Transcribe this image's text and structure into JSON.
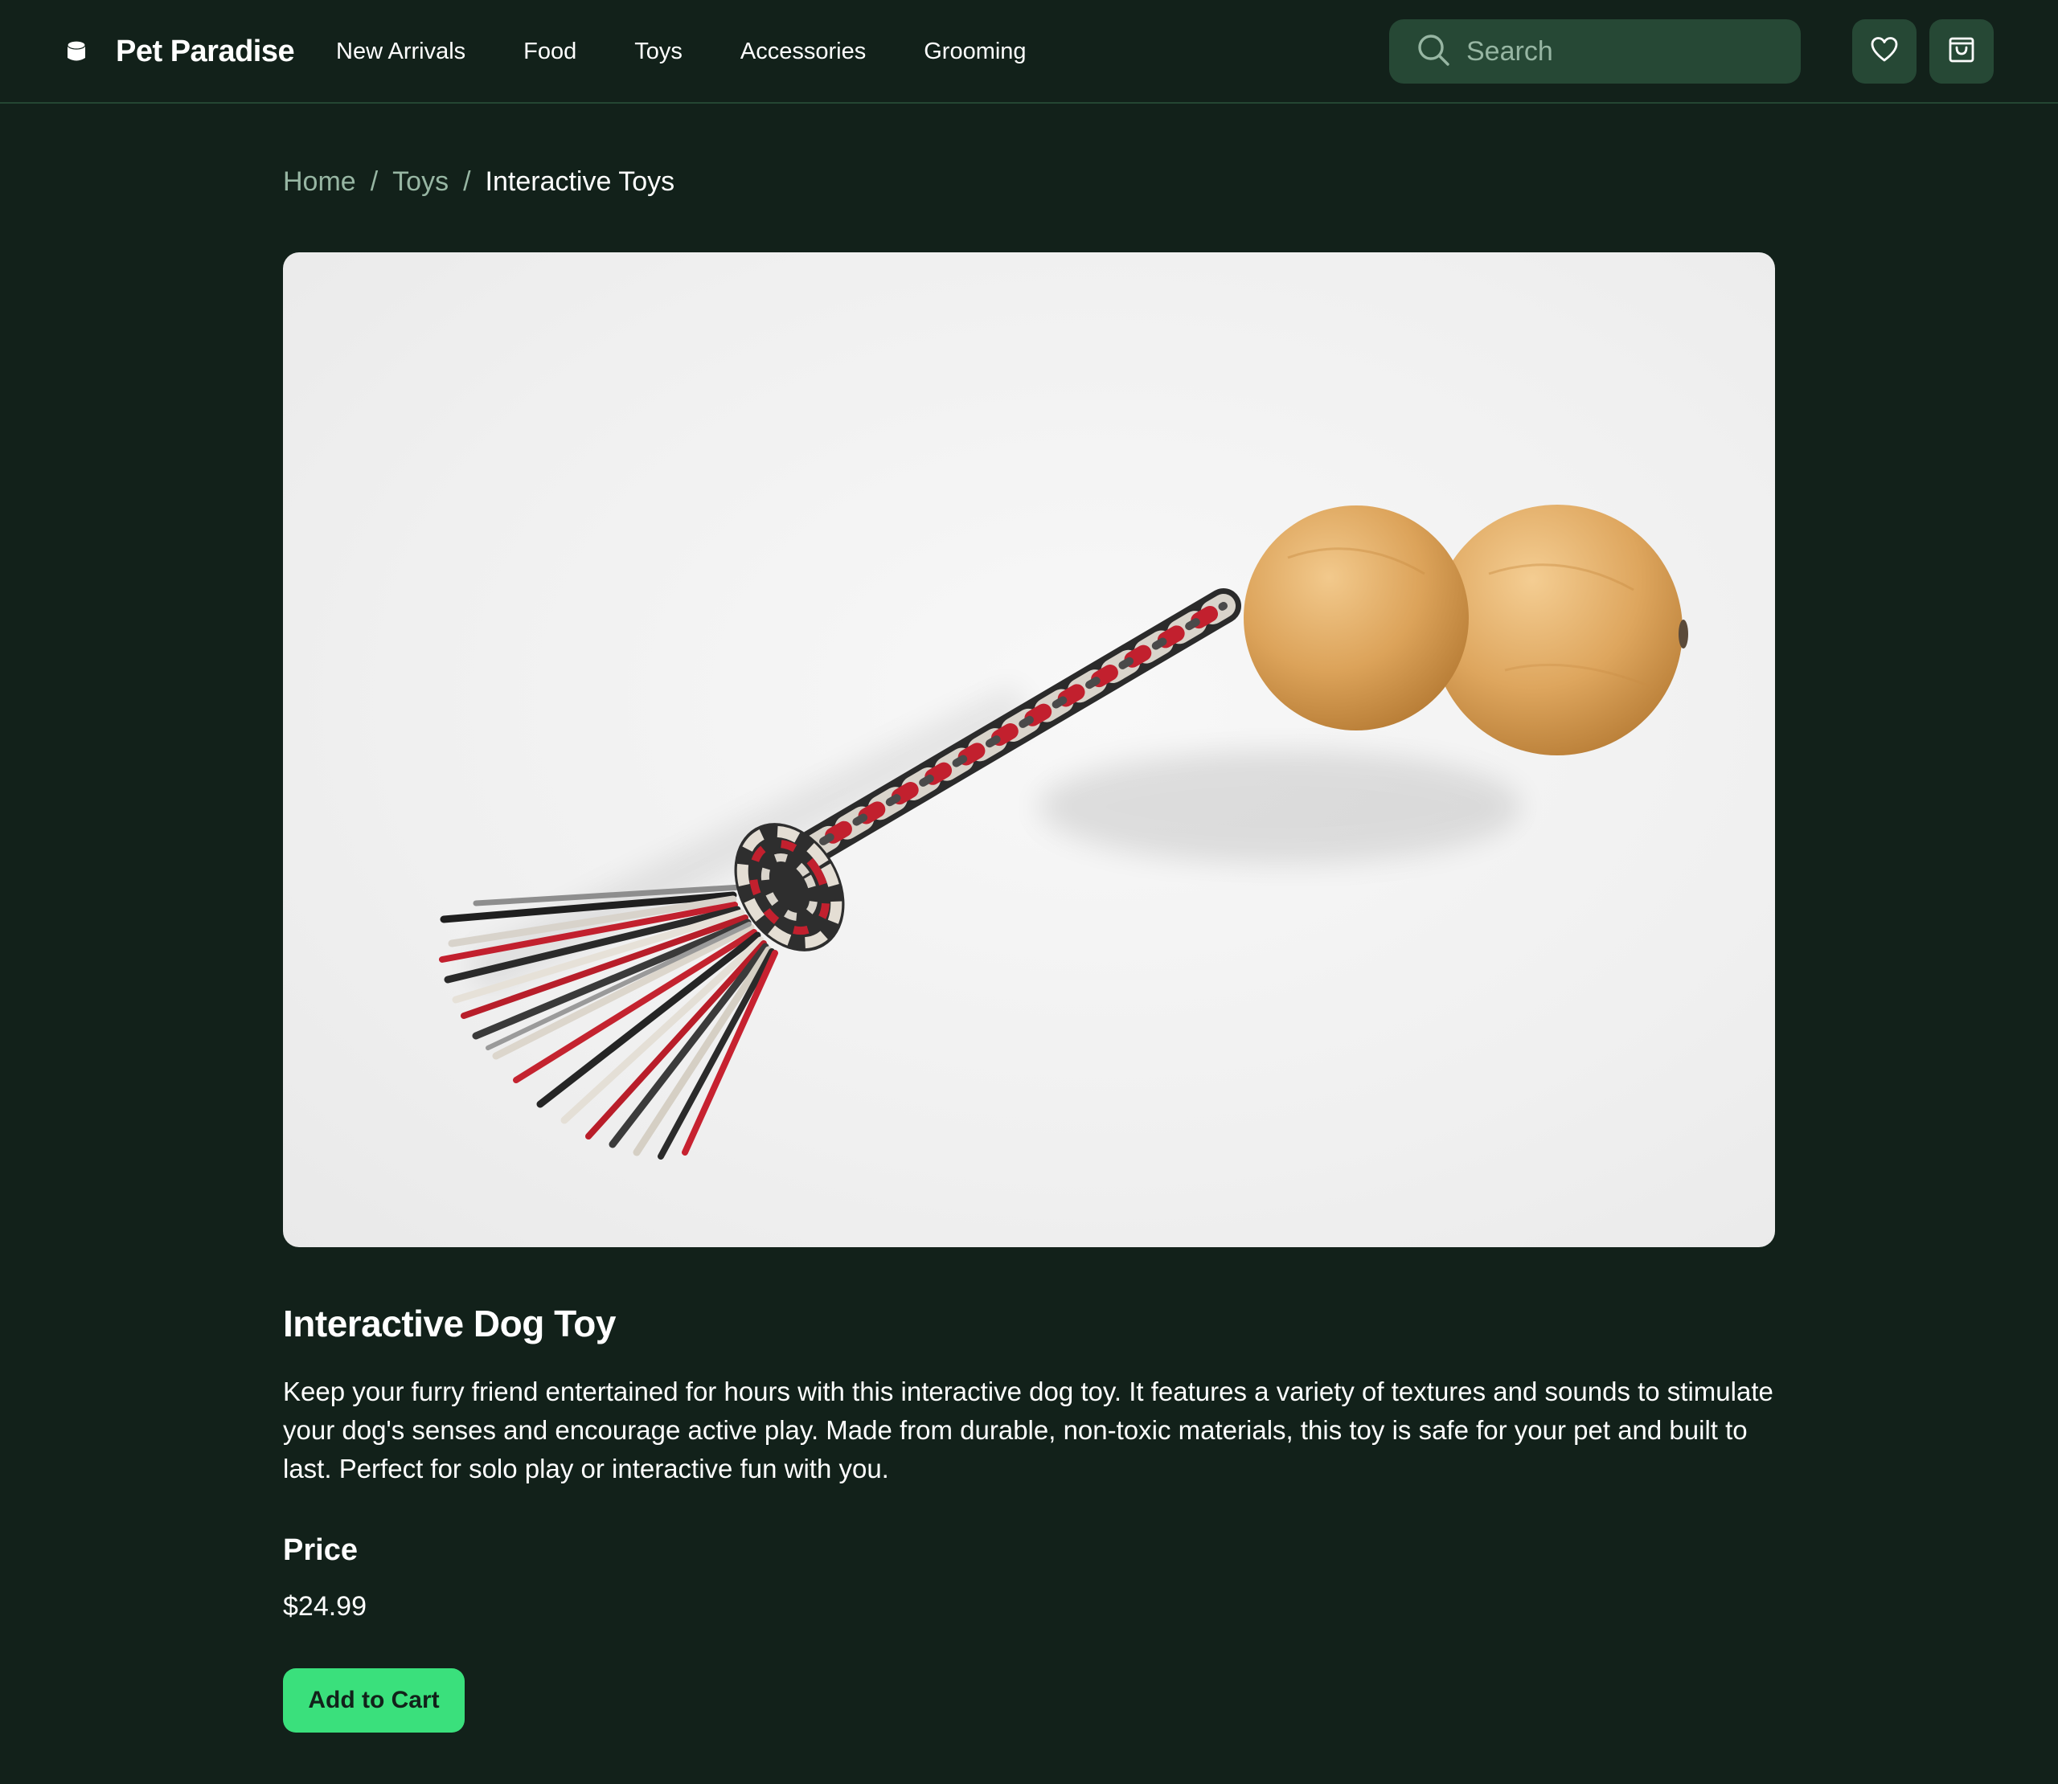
{
  "header": {
    "brand_name": "Pet Paradise",
    "brand_icon": "pet-paradise-logo-icon",
    "nav": [
      {
        "label": "New Arrivals"
      },
      {
        "label": "Food"
      },
      {
        "label": "Toys"
      },
      {
        "label": "Accessories"
      },
      {
        "label": "Grooming"
      }
    ],
    "search": {
      "placeholder": "Search",
      "icon": "search-icon"
    },
    "wishlist_icon": "heart-icon",
    "cart_icon": "shopping-bag-icon"
  },
  "breadcrumb": [
    {
      "label": "Home"
    },
    {
      "label": "Toys"
    },
    {
      "label": "Interactive Toys"
    }
  ],
  "breadcrumb_separator": "/",
  "product": {
    "image": "rope-dog-toy-with-two-wooden-balls",
    "title": "Interactive Dog Toy",
    "description": "Keep your furry friend entertained for hours with this interactive dog toy. It features a variety of textures and sounds to stimulate your dog's senses and encourage active play. Made from durable, non-toxic materials, this toy is safe for your pet and built to last. Perfect for solo play or interactive fun with you.",
    "price_heading": "Price",
    "price": "$24.99",
    "add_to_cart_label": "Add to Cart"
  },
  "colors": {
    "background": "#12211a",
    "surface": "#264835",
    "muted_text": "#97b6a3",
    "accent": "#3ae07c"
  }
}
